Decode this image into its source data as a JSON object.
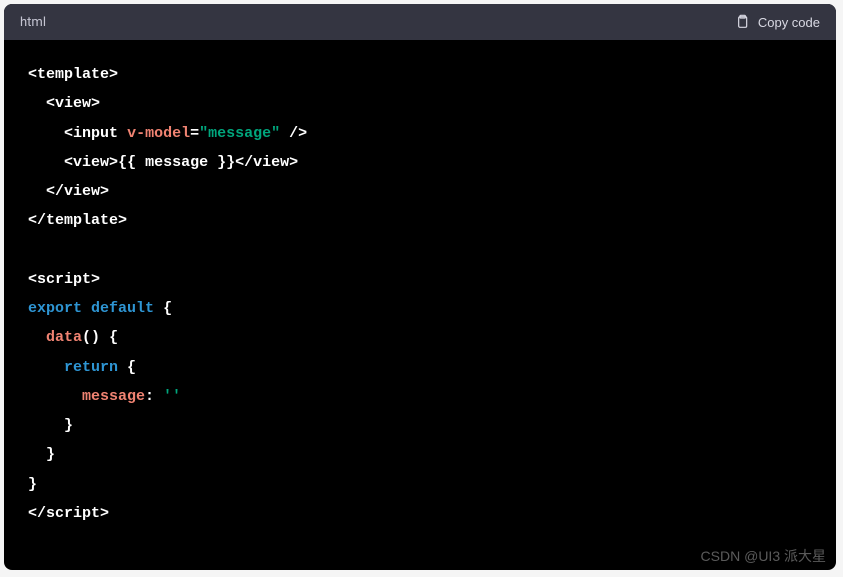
{
  "header": {
    "language": "html",
    "copyLabel": "Copy code"
  },
  "code": {
    "line1": {
      "open": "<",
      "tag": "template",
      "close": ">"
    },
    "line2": {
      "indent": "  ",
      "open": "<",
      "tag": "view",
      "close": ">"
    },
    "line3": {
      "indent": "    ",
      "open": "<",
      "tag": "input",
      "sp": " ",
      "attr": "v-model",
      "eq": "=",
      "val": "\"message\"",
      "close": " />"
    },
    "line4": {
      "indent": "    ",
      "open": "<",
      "tag": "view",
      "close": ">",
      "text": "{{ message }}",
      "open2": "</",
      "tag2": "view",
      "close2": ">"
    },
    "line5": {
      "indent": "  ",
      "open": "</",
      "tag": "view",
      "close": ">"
    },
    "line6": {
      "open": "</",
      "tag": "template",
      "close": ">"
    },
    "line7": "",
    "line8": {
      "open": "<",
      "tag": "script",
      "close": ">"
    },
    "line9": {
      "export": "export",
      "sp": " ",
      "default": "default",
      "sp2": " ",
      "brace": "{"
    },
    "line10": {
      "indent": "  ",
      "fn": "data",
      "parens": "()",
      "sp": " ",
      "brace": "{"
    },
    "line11": {
      "indent": "    ",
      "return": "return",
      "sp": " ",
      "brace": "{"
    },
    "line12": {
      "indent": "      ",
      "prop": "message",
      "colon": ": ",
      "val": "''"
    },
    "line13": {
      "indent": "    ",
      "brace": "}"
    },
    "line14": {
      "indent": "  ",
      "brace": "}"
    },
    "line15": {
      "brace": "}"
    },
    "line16": {
      "open": "</",
      "tag": "script",
      "close": ">"
    }
  },
  "watermark": "CSDN @UI3 派大星"
}
